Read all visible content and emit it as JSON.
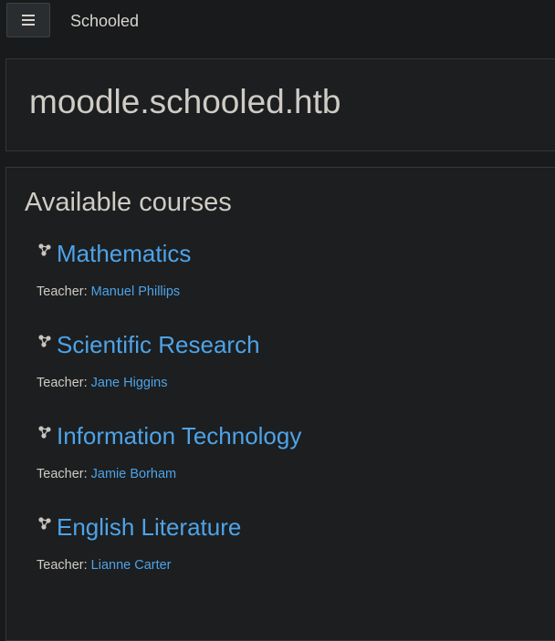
{
  "navbar": {
    "menu_icon": "hamburger-icon",
    "site_name": "Schooled"
  },
  "page": {
    "title": "moodle.schooled.htb"
  },
  "courses_section": {
    "title": "Available courses",
    "teacher_label": "Teacher:",
    "course_icon": "course-icon",
    "courses": [
      {
        "name": "Mathematics",
        "teacher": "Manuel Phillips"
      },
      {
        "name": "Scientific Research",
        "teacher": "Jane Higgins"
      },
      {
        "name": "Information Technology",
        "teacher": "Jamie Borham"
      },
      {
        "name": "English Literature",
        "teacher": "Lianne Carter"
      }
    ]
  },
  "colors": {
    "background": "#181a1b",
    "link": "#4ea3e8",
    "text": "#cfcbc5"
  }
}
